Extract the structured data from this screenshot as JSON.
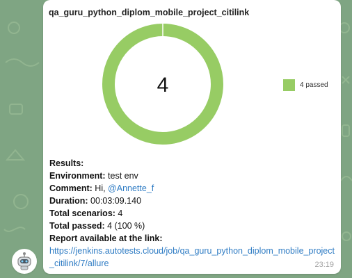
{
  "message": {
    "chart_title": "qa_guru_python_diplom_mobile_project_citilink",
    "time": "23:19",
    "results_label": "Results:",
    "environment_label": "Environment:",
    "environment_value": " test env",
    "comment_label": "Comment:",
    "comment_prefix": " Hi, ",
    "comment_mention": "@Annette_f",
    "duration_label": "Duration:",
    "duration_value": " 00:03:09.140",
    "total_scenarios_label": "Total scenarios:",
    "total_scenarios_value": " 4",
    "total_passed_label": "Total passed:",
    "total_passed_value": " 4 (100 %)",
    "report_label": "Report available at the link:",
    "report_url": "https://jenkins.autotests.cloud/job/qa_guru_python_diplom_mobile_project_citilink/7/allure"
  },
  "chart_data": {
    "type": "pie",
    "center_label": "4",
    "categories": [
      "4 passed"
    ],
    "values": [
      4
    ],
    "colors": [
      "#97cc64"
    ],
    "legend_position": "right"
  },
  "colors": {
    "background": "#7fa583",
    "bubble": "#ffffff",
    "link": "#2f7cc4",
    "passed": "#97cc64"
  },
  "icons": {
    "avatar": "robot-icon"
  }
}
